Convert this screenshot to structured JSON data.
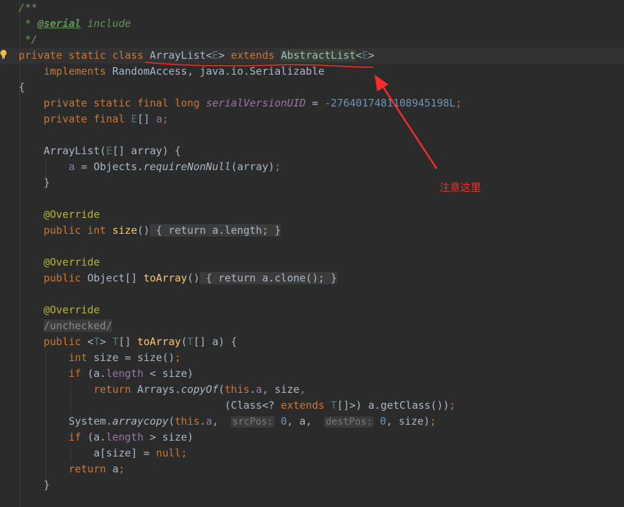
{
  "editor": {
    "lines": {
      "l1": "/**",
      "l2_star": " * ",
      "l2_tag": "@serial",
      "l2_text": " include",
      "l3": " */",
      "l4_kw": "private static class ",
      "l4_cls": "ArrayList",
      "l4_lt": "<",
      "l4_E": "E",
      "l4_gt": "> ",
      "l4_ext": "extends ",
      "l4_sup": "AbstractList",
      "l4_lt2": "<",
      "l4_E2": "E",
      "l4_gt2": ">",
      "l5": "    implements RandomAccess, java.io.Serializable",
      "l6": "{",
      "l7_kw": "    private static final long ",
      "l7_field": "serialVersionUID",
      "l7_eq": " = ",
      "l7_num": "-2764017481108945198L",
      "l7_semi": ";",
      "l8_kw": "    private final ",
      "l8_E": "E",
      "l8_rest": "[] ",
      "l8_field": "a",
      "l8_semi": ";",
      "l10_a": "    ArrayList(",
      "l10_E": "E",
      "l10_b": "[] array) {",
      "l11_pre": "        ",
      "l11_field": "a",
      "l11_a": " = Objects.",
      "l11_m": "requireNonNull",
      "l11_b": "(array)",
      "l11_semi": ";",
      "l12": "    }",
      "l14": "    @Override",
      "l15_kw": "    public int ",
      "l15_fn": "size",
      "l15_p": "()",
      "l15_ob": " { ",
      "l15_ret": "return ",
      "l15_f": "a",
      "l15_dot": ".",
      "l15_len": "length",
      "l15_semi": ";",
      "l15_cb": " }",
      "l17": "    @Override",
      "l18_kw": "    public ",
      "l18_a": "Object[] ",
      "l18_fn": "toArray",
      "l18_p": "()",
      "l18_ob": " { ",
      "l18_ret": "return ",
      "l18_f": "a",
      "l18_b": ".clone()",
      "l18_semi": ";",
      "l18_cb": " }",
      "l20": "    @Override",
      "l21_pre": "    ",
      "l21_fold": "/unchecked/",
      "l22_kw": "    public ",
      "l22_lt": "<",
      "l22_T": "T",
      "l22_gt": "> ",
      "l22_T2": "T",
      "l22_a": "[] ",
      "l22_fn": "toArray",
      "l22_b": "(",
      "l22_T3": "T",
      "l22_c": "[] a) {",
      "l23_kw": "        int ",
      "l23_a": "size = size()",
      "l23_semi": ";",
      "l24_kw": "        if ",
      "l24_a": "(a.",
      "l24_f": "length",
      "l24_b": " < size)",
      "l25_kw": "            return ",
      "l25_a": "Arrays.",
      "l25_m": "copyOf",
      "l25_b": "(",
      "l25_this": "this",
      "l25_c": ".",
      "l25_f": "a",
      "l25_d": ", size",
      "l25_comma": ",",
      "l26_pre": "                                 (Class<? ",
      "l26_ext": "extends ",
      "l26_T": "T",
      "l26_a": "[]>) a.getClass())",
      "l26_semi": ";",
      "l27_pre": "        System.",
      "l27_m": "arraycopy",
      "l27_a": "(",
      "l27_this": "this",
      "l27_b": ".",
      "l27_f": "a",
      "l27_c": ",  ",
      "l27_h1": "srcPos:",
      "l27_num1": " 0",
      "l27_d": ", a,  ",
      "l27_h2": "destPos:",
      "l27_num2": " 0",
      "l27_e": ", size)",
      "l27_semi": ";",
      "l28_kw": "        if ",
      "l28_a": "(a.",
      "l28_f": "length",
      "l28_b": " > size)",
      "l29_a": "            a[size] = ",
      "l29_kw": "null",
      "l29_semi": ";",
      "l30_kw": "        return ",
      "l30_a": "a",
      "l30_semi": ";",
      "l31": "    }"
    }
  },
  "annotation": {
    "text": "注意这里",
    "color": "#ff2a2a"
  },
  "icons": {
    "bulb": "lightbulb-icon"
  }
}
